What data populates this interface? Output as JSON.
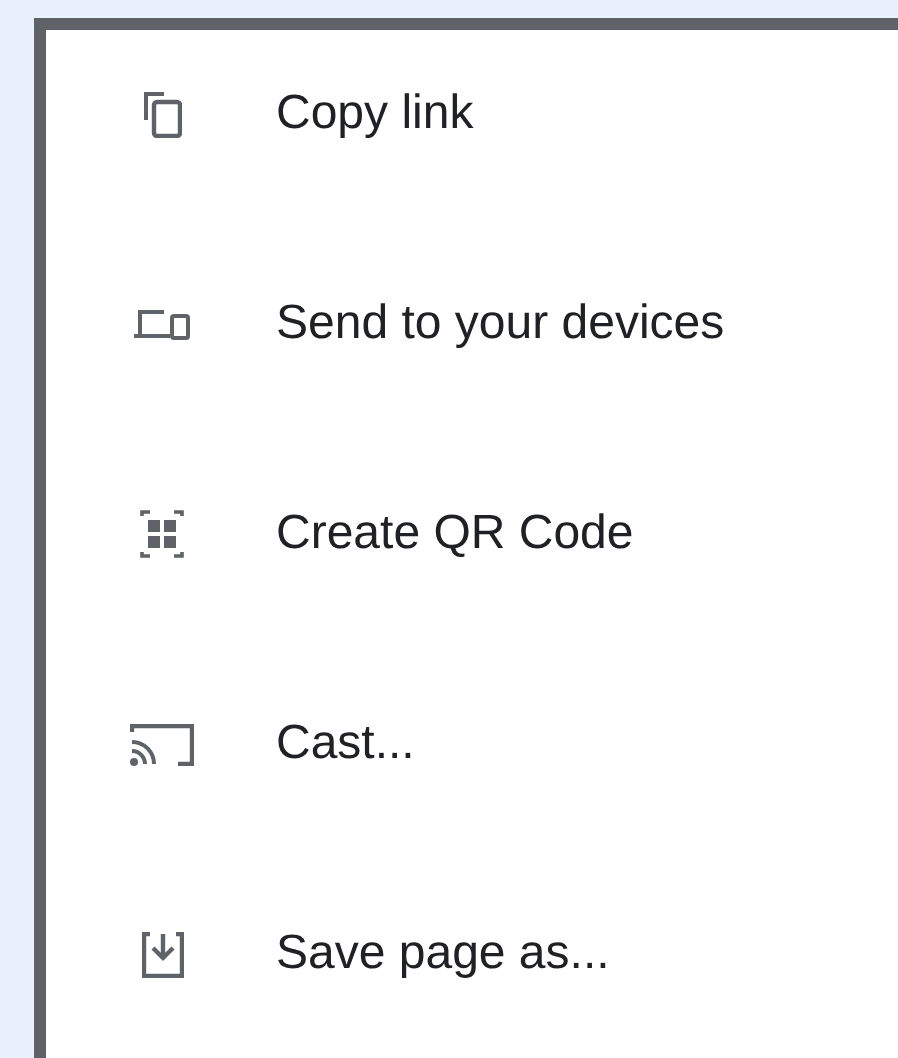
{
  "menu": {
    "items": [
      {
        "kind": "copy",
        "label": "Copy link"
      },
      {
        "kind": "devices",
        "label": "Send to your devices"
      },
      {
        "kind": "qr",
        "label": "Create QR Code"
      },
      {
        "kind": "cast",
        "label": "Cast..."
      },
      {
        "kind": "save",
        "label": "Save page as..."
      }
    ]
  }
}
